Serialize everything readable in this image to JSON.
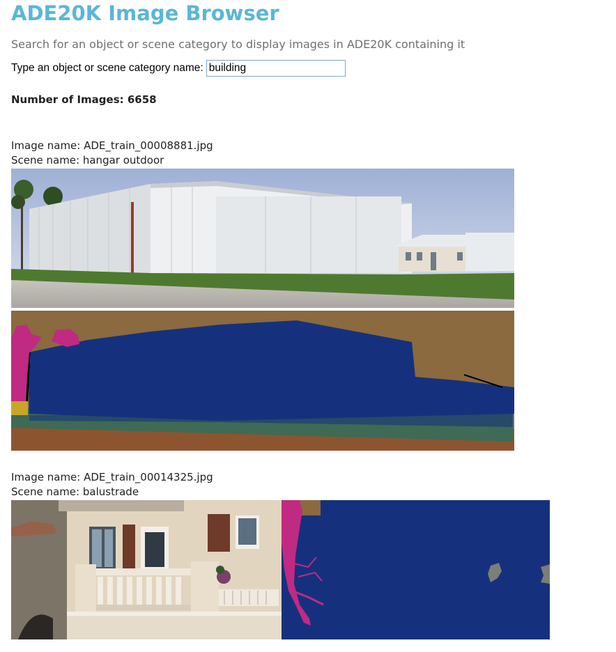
{
  "header": {
    "title": "ADE20K Image Browser",
    "subtitle": "Search for an object or scene category to display images in ADE20K containing it"
  },
  "search": {
    "label": "Type an object or scene category name:",
    "value": "building"
  },
  "results": {
    "count_text": "Number of Images: 6658",
    "items": [
      {
        "image_name_text": "Image name: ADE_train_00008881.jpg",
        "scene_name_text": "Scene name: hangar outdoor",
        "photo_icon": "hangar-photo",
        "segmentation_icon": "segmentation-mask"
      },
      {
        "image_name_text": "Image name: ADE_train_00014325.jpg",
        "scene_name_text": "Scene name: balustrade",
        "photo_icon": "balustrade-photo",
        "segmentation_icon": "segmentation-mask"
      }
    ]
  },
  "colors": {
    "title": "#5ab6d8",
    "segmentation_building": "#15317e",
    "segmentation_sky": "#8a6a3e",
    "segmentation_tree": "#c02a82",
    "segmentation_grass": "#3f6a55",
    "segmentation_road": "#8c5530"
  }
}
